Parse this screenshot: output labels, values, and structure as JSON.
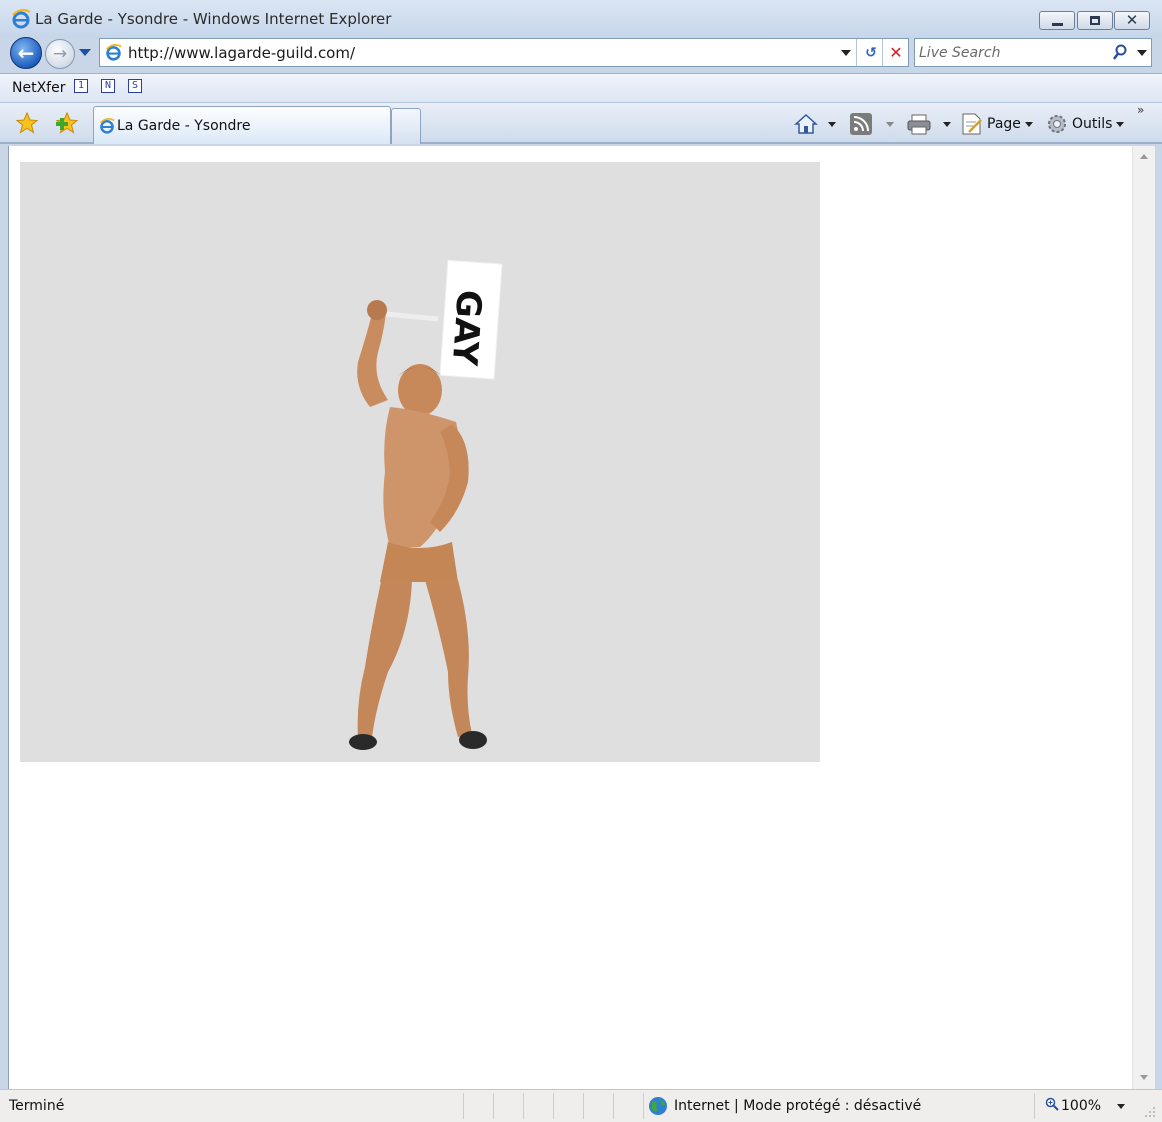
{
  "window": {
    "title": "La Garde - Ysondre - Windows Internet Explorer"
  },
  "navigation": {
    "url": "http://www.lagarde-guild.com/",
    "search_placeholder": "Live Search"
  },
  "links_bar": {
    "label": "NetXfer",
    "items": [
      "1",
      "N",
      "S"
    ]
  },
  "tabs": [
    {
      "label": "La Garde - Ysondre",
      "active": true
    }
  ],
  "command_bar": {
    "page_label": "Page",
    "tools_label": "Outils"
  },
  "page": {
    "image_sign_text": "GAY",
    "image_background": "#dfdfdf"
  },
  "status_bar": {
    "status": "Terminé",
    "zone": "Internet | Mode protégé : désactivé",
    "zoom": "100%"
  },
  "icons": {
    "title": "ie-logo-icon",
    "back": "back-arrow-icon",
    "forward": "forward-arrow-icon",
    "refresh": "refresh-icon",
    "stop": "stop-icon",
    "search": "search-icon",
    "favorites": "favorites-star-icon",
    "add_favorite": "add-favorite-icon",
    "home": "home-icon",
    "feeds": "rss-feed-icon",
    "print": "printer-icon",
    "page": "page-icon",
    "tools": "gear-icon",
    "globe": "globe-icon",
    "zoom": "zoom-icon"
  }
}
